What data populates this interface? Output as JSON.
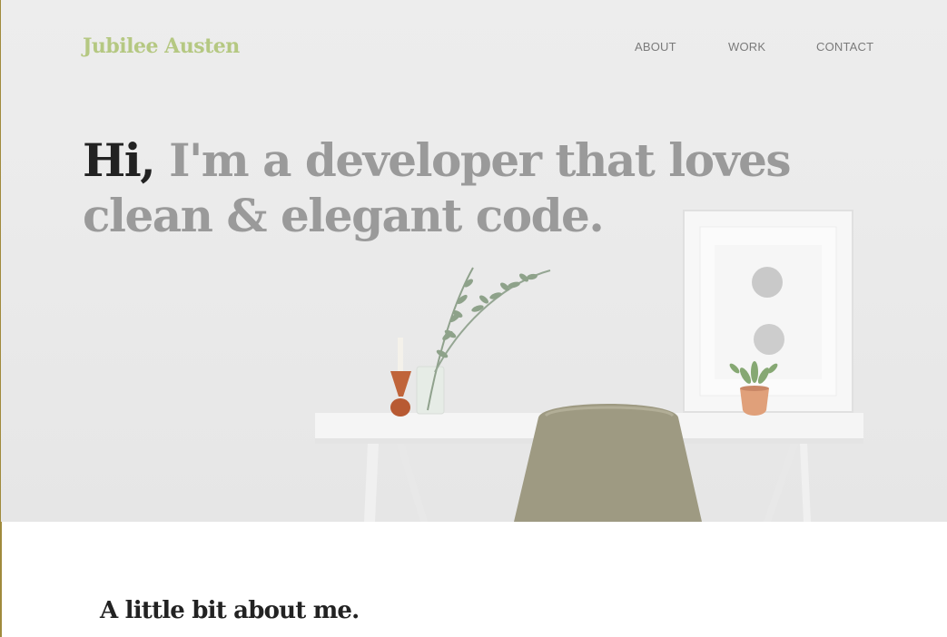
{
  "site": {
    "logo": "Jubilee Austen"
  },
  "nav": {
    "items": [
      {
        "label": "ABOUT"
      },
      {
        "label": "WORK"
      },
      {
        "label": "CONTACT"
      }
    ]
  },
  "hero": {
    "greeting": "Hi,",
    "tagline": " I'm a developer that loves clean & elegant code."
  },
  "about": {
    "heading": "A little bit about me."
  },
  "colors": {
    "logo": "#b5c882",
    "headline_muted": "#9a9a9a",
    "headline_strong": "#222222",
    "nav_text": "#7a7a7a",
    "page_background": "#ffffff"
  }
}
